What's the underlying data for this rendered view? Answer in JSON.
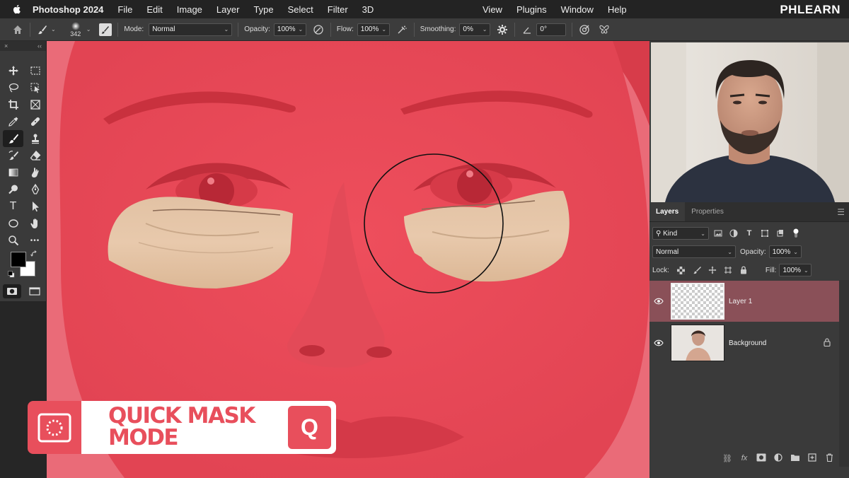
{
  "menubar": {
    "app_name": "Photoshop 2024",
    "left_items": [
      "File",
      "Edit",
      "Image",
      "Layer",
      "Type",
      "Select",
      "Filter",
      "3D"
    ],
    "right_items": [
      "View",
      "Plugins",
      "Window",
      "Help"
    ],
    "brand": "PHLEARN"
  },
  "options": {
    "brush_size": "342",
    "mode_label": "Mode:",
    "mode_value": "Normal",
    "opacity_label": "Opacity:",
    "opacity_value": "100%",
    "flow_label": "Flow:",
    "flow_value": "100%",
    "smoothing_label": "Smoothing:",
    "smoothing_value": "0%",
    "angle_value": "0°"
  },
  "tools": {
    "header_close": "×",
    "header_collapse": "‹‹",
    "items": [
      "move-tool",
      "marquee-tool",
      "lasso-tool",
      "object-select-tool",
      "crop-tool",
      "frame-tool",
      "eyedropper-tool",
      "healing-tool",
      "brush-tool",
      "stamp-tool",
      "history-brush-tool",
      "eraser-tool",
      "gradient-tool",
      "smudge-tool",
      "dodge-tool",
      "pen-tool",
      "type-tool",
      "path-select-tool",
      "shape-tool",
      "hand-tool",
      "zoom-tool",
      "more-tools"
    ],
    "type_glyph": "T",
    "more_glyph": "•••",
    "foreground_color": "#000000",
    "background_color": "#ffffff"
  },
  "lower_third": {
    "title": "QUICK MASK MODE",
    "key": "Q",
    "accent": "#e84f5c"
  },
  "layers_panel": {
    "tabs": [
      "Layers",
      "Properties"
    ],
    "filter_value": "Kind",
    "blend_mode": "Normal",
    "opacity_label": "Opacity:",
    "opacity_value": "100%",
    "lock_label": "Lock:",
    "fill_label": "Fill:",
    "fill_value": "100%",
    "layers": [
      {
        "name": "Layer 1",
        "selected": true,
        "locked": false
      },
      {
        "name": "Background",
        "selected": false,
        "locked": true
      }
    ],
    "footer_fx": "fx"
  },
  "colors": {
    "mask_red": "#e86470",
    "panel": "#3a3a3a",
    "selected_layer": "#8a5058"
  }
}
